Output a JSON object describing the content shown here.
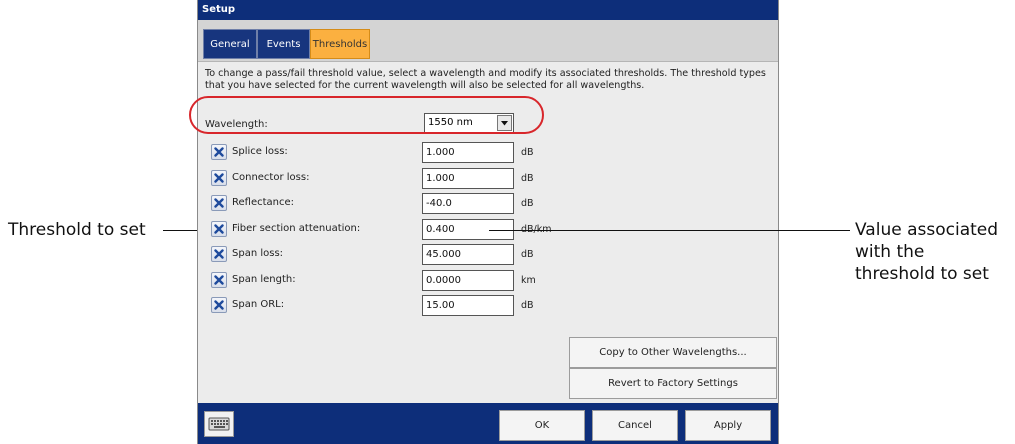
{
  "window": {
    "title": "Setup"
  },
  "tabs": [
    {
      "label": "General",
      "active": false
    },
    {
      "label": "Events",
      "active": false
    },
    {
      "label": "Thresholds",
      "active": true
    }
  ],
  "description": "To change a pass/fail threshold value, select a wavelength and modify its associated thresholds. The threshold types that you have selected for the current wavelength will also be selected for all wavelengths.",
  "wavelength": {
    "label": "Wavelength:",
    "value": "1550 nm"
  },
  "thresholds": [
    {
      "label": "Splice loss:",
      "value": "1.000",
      "unit": "dB",
      "checked": true
    },
    {
      "label": "Connector loss:",
      "value": "1.000",
      "unit": "dB",
      "checked": true
    },
    {
      "label": "Reflectance:",
      "value": "-40.0",
      "unit": "dB",
      "checked": true
    },
    {
      "label": "Fiber section attenuation:",
      "value": "0.400",
      "unit": "dB/km",
      "checked": true
    },
    {
      "label": "Span loss:",
      "value": "45.000",
      "unit": "dB",
      "checked": true
    },
    {
      "label": "Span length:",
      "value": "0.0000",
      "unit": "km",
      "checked": true
    },
    {
      "label": "Span ORL:",
      "value": "15.00",
      "unit": "dB",
      "checked": true
    }
  ],
  "actions": {
    "copy": "Copy to Other Wavelengths...",
    "revert": "Revert to Factory Settings"
  },
  "footer": {
    "ok": "OK",
    "cancel": "Cancel",
    "apply": "Apply"
  },
  "callouts": {
    "left": "Threshold to set",
    "right_line1": "Value associated",
    "right_line2": "with the",
    "right_line3": "threshold to set"
  },
  "colors": {
    "title_bar": "#0d2e7a",
    "active_tab": "#fbb040",
    "highlight": "#d8262b"
  },
  "icons": {
    "checkbox": "x-mark-icon",
    "dropdown": "chevron-down-icon",
    "keyboard": "keyboard-icon"
  }
}
